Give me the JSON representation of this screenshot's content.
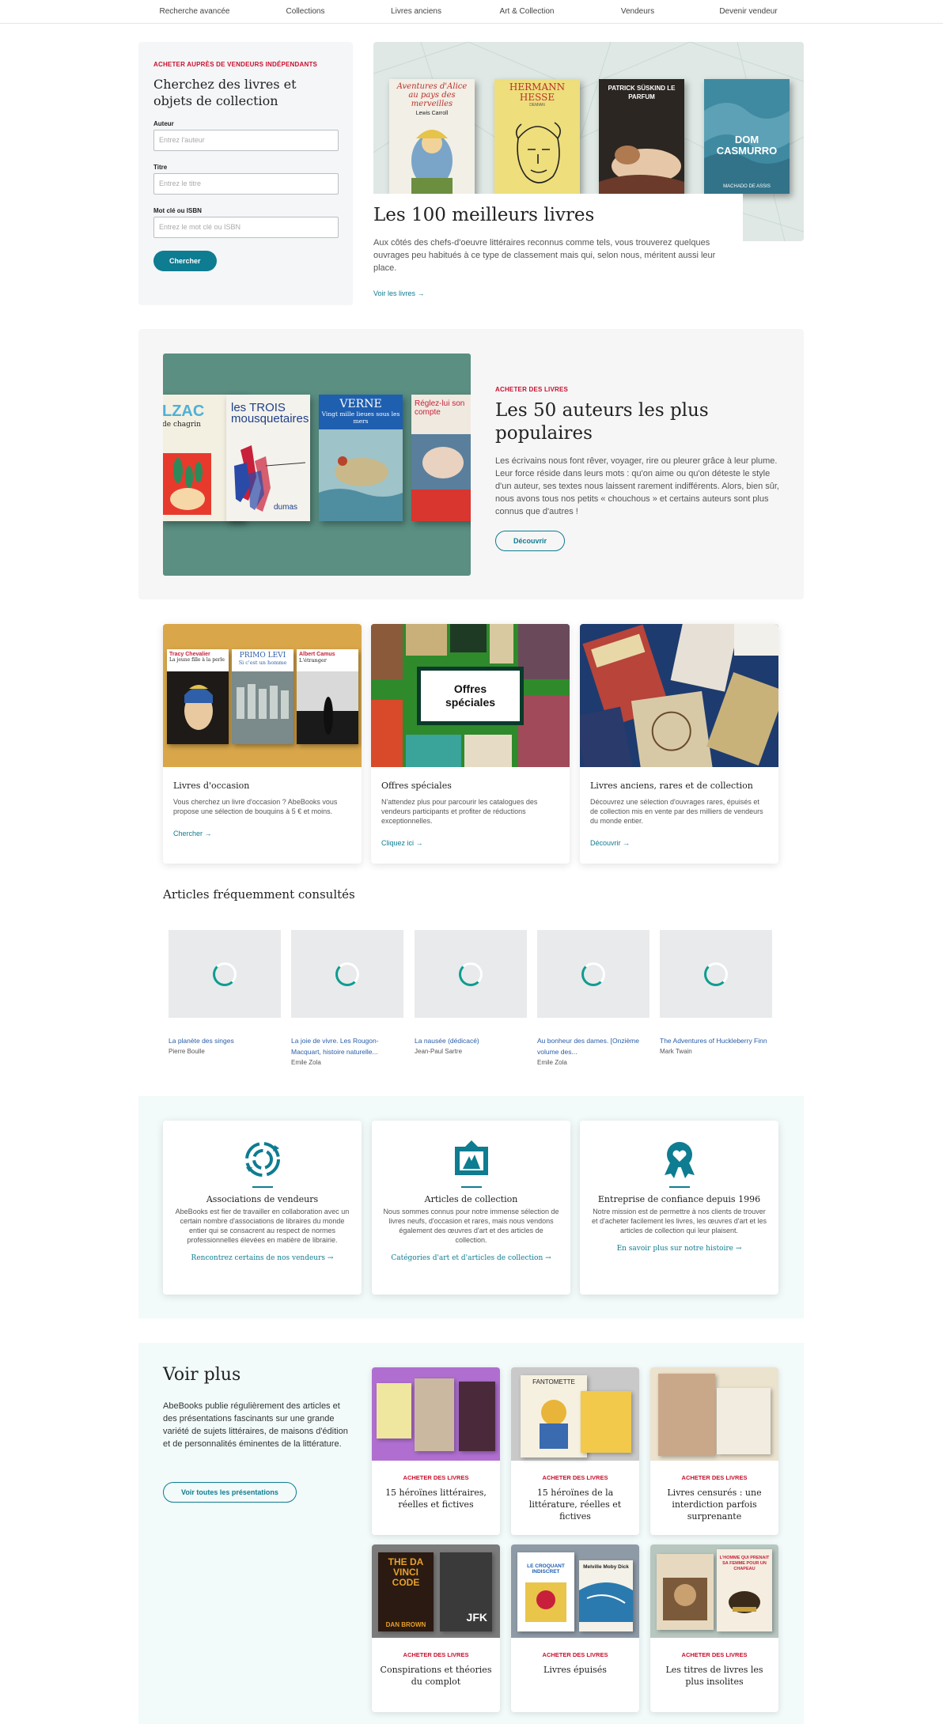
{
  "nav": [
    "Recherche avancée",
    "Collections",
    "Livres anciens",
    "Art & Collection",
    "Vendeurs",
    "Devenir vendeur"
  ],
  "search": {
    "eyebrow": "ACHETER AUPRÈS DE VENDEURS INDÉPENDANTS",
    "title": "Cherchez des livres et objets de collection",
    "author_label": "Auteur",
    "author_placeholder": "Entrez l'auteur",
    "title_label": "Titre",
    "title_placeholder": "Entrez le titre",
    "keyword_label": "Mot clé ou ISBN",
    "keyword_placeholder": "Entrez le mot clé ou ISBN",
    "button": "Chercher"
  },
  "hero": {
    "title": "Les 100 meilleurs livres",
    "text": "Aux côtés des chefs-d'oeuvre littéraires reconnus comme tels, vous trouverez quelques ouvrages peu habitués à ce type de classement mais qui, selon nous, méritent aussi leur place.",
    "link": "Voir les livres",
    "books": [
      {
        "title": "Aventures d'Alice au pays des merveilles",
        "author": "Lewis Carroll",
        "color": "#f2efe6"
      },
      {
        "title": "HERMANN HESSE",
        "author": "DEMIAN",
        "color": "#eede7c"
      },
      {
        "title": "PATRICK SÜSKIND LE PARFUM",
        "author": "",
        "color": "#2b2622"
      },
      {
        "title": "DOM CASMURRO",
        "author": "MACHADO DE ASSIS",
        "color": "#3f8aa0"
      }
    ]
  },
  "authors": {
    "eyebrow": "ACHETER DES LIVRES",
    "title": "Les 50 auteurs les plus populaires",
    "text": "Les écrivains nous font rêver, voyager, rire ou pleurer grâce à leur plume. Leur force réside dans leurs mots : qu'on aime ou qu'on déteste le style d'un auteur, ses textes nous laissent rarement indifférents. Alors, bien sûr, nous avons tous nos petits « chouchous » et certains auteurs sont plus connus que d'autres !",
    "button": "Découvrir",
    "books": [
      {
        "title": "LZAC",
        "sub": "de chagrin"
      },
      {
        "title": "les TROIS mousquetaires",
        "sub": "dumas"
      },
      {
        "title": "VERNE",
        "sub": "Vingt mille lieues sous les mers"
      },
      {
        "title": "Réglez-lui son compte",
        "sub": ""
      }
    ]
  },
  "categories": [
    {
      "title": "Livres d'occasion",
      "text": "Vous cherchez un livre d'occasion ? AbeBooks vous propose une sélection de bouquins à 5 € et moins.",
      "link": "Chercher",
      "bg": "#d9a74a"
    },
    {
      "title": "Offres spéciales",
      "text": "N'attendez plus pour parcourir les catalogues des vendeurs participants et profiter de réductions exceptionnelles.",
      "link": "Cliquez ici",
      "bg": "#2f8a2b",
      "overlay": "Offres spéciales"
    },
    {
      "title": "Livres anciens, rares et de collection",
      "text": "Découvrez une sélection d'ouvrages rares, épuisés et de collection mis en vente par des milliers de vendeurs du monde entier.",
      "link": "Découvrir",
      "bg": "#1d3b6e"
    }
  ],
  "cat_book_labels": {
    "chevalier_author": "Tracy Chevalier",
    "chevalier_title": "La jeune fille à la perle",
    "levi_author": "PRIMO LEVI",
    "levi_title": "Si c'est un homme",
    "camus_author": "Albert Camus",
    "camus_title": "L'étranger"
  },
  "frequent": {
    "title": "Articles fréquemment consultés",
    "items": [
      {
        "title": "La planète des singes",
        "author": "Pierre Boulle"
      },
      {
        "title": "La joie de vivre. Les Rougon-Macquart, histoire naturelle...",
        "author": "Emile Zola"
      },
      {
        "title": "La nausée (dédicacé)",
        "author": "Jean-Paul Sartre"
      },
      {
        "title": "Au bonheur des dames. [Onzième volume des...",
        "author": "Emile Zola"
      },
      {
        "title": "The Adventures of Huckleberry Finn",
        "author": "Mark Twain"
      }
    ]
  },
  "features": [
    {
      "icon": "recycle-icon",
      "title": "Associations de vendeurs",
      "text": "AbeBooks est fier de travailler en collaboration avec un certain nombre d'associations de libraires du monde entier qui se consacrent au respect de normes professionnelles élevées en matière de librairie.",
      "link": "Rencontrez certains de nos vendeurs"
    },
    {
      "icon": "art-frame-icon",
      "title": "Articles de collection",
      "text": "Nous sommes connus pour notre immense sélection de livres neufs, d'occasion et rares, mais nous vendons également des œuvres d'art et des articles de collection.",
      "link": "Catégories d'art et d'articles de collection"
    },
    {
      "icon": "award-ribbon-icon",
      "title": "Entreprise de confiance depuis 1996",
      "text": "Notre mission est de permettre à nos clients de trouver et d'acheter facilement les livres, les œuvres d'art et les articles de collection qui leur plaisent.",
      "link": "En savoir plus sur notre histoire"
    }
  ],
  "more": {
    "title": "Voir plus",
    "text": "AbeBooks publie régulièrement des articles et des présentations fascinants sur une grande variété de sujets littéraires, de maisons d'édition et de personnalités éminentes de la littérature.",
    "button": "Voir toutes les présentations",
    "items": [
      {
        "eyebrow": "ACHETER DES LIVRES",
        "title": "15 héroïnes littéraires, réelles et fictives",
        "bg": "#b06fd0"
      },
      {
        "eyebrow": "ACHETER DES LIVRES",
        "title": "15 héroïnes de la littérature, réelles et fictives",
        "bg": "#c9c9c9"
      },
      {
        "eyebrow": "ACHETER DES LIVRES",
        "title": "Livres censurés : une interdiction parfois surprenante",
        "bg": "#ece3cf"
      },
      {
        "eyebrow": "ACHETER DES LIVRES",
        "title": "Conspirations et théories du complot",
        "bg": "#7b7b7b"
      },
      {
        "eyebrow": "ACHETER DES LIVRES",
        "title": "Livres épuisés",
        "bg": "#8e9aa6"
      },
      {
        "eyebrow": "ACHETER DES LIVRES",
        "title": "Les titres de livres les plus insolites",
        "bg": "#b7c7c0"
      }
    ],
    "book_labels": {
      "fantomette": "FANTOMETTE",
      "croquant": "LE CROQUANT INDISCRET",
      "melville": "Melville Moby Dick",
      "davinci": "THE DA VINCI CODE",
      "danbrown": "DAN BROWN",
      "jfk": "JFK",
      "homme": "L'HOMME QUI PRENAIT SA FEMME POUR UN CHAPEAU"
    }
  },
  "colors": {
    "accent": "#0e7c91",
    "eyebrow": "#c8102e",
    "panel": "#5a8f82",
    "light_bg": "#f2fafa"
  }
}
